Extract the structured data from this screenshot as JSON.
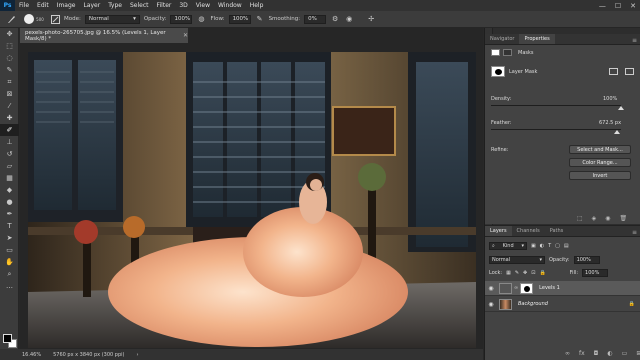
{
  "menubar": {
    "logo": "Ps",
    "items": [
      "File",
      "Edit",
      "Image",
      "Layer",
      "Type",
      "Select",
      "Filter",
      "3D",
      "View",
      "Window",
      "Help"
    ],
    "window_controls": [
      "—",
      "☐",
      "✕"
    ]
  },
  "options_bar": {
    "brush_size": "500",
    "mode_label": "Mode:",
    "mode_value": "Normal",
    "opacity_label": "Opacity:",
    "opacity_value": "100%",
    "flow_label": "Flow:",
    "flow_value": "100%",
    "smoothing_label": "Smoothing:",
    "smoothing_value": "0%"
  },
  "document": {
    "tab_title": "pexels-photo-265705.jpg @ 16.5% (Levels 1, Layer Mask/8) *",
    "zoom": "16.46%",
    "doc_info": "5760 px x 3840 px (300 ppi)"
  },
  "properties_panel": {
    "tabs": [
      "Navigator",
      "Properties"
    ],
    "active_tab": "Properties",
    "masks_label": "Masks",
    "layer_mask_label": "Layer Mask",
    "density_label": "Density:",
    "density_value": "100%",
    "density_level": 1.0,
    "feather_label": "Feather:",
    "feather_value": "672.5 px",
    "feather_level": 0.97,
    "refine_label": "Refine:",
    "select_and_mask": "Select and Mask...",
    "color_range": "Color Range...",
    "invert": "Invert"
  },
  "layers_panel": {
    "tabs": [
      "Layers",
      "Channels",
      "Paths"
    ],
    "active_tab": "Layers",
    "kind_label": "Kind",
    "blend_mode": "Normal",
    "opacity_label": "Opacity:",
    "opacity_value": "100%",
    "lock_label": "Lock:",
    "fill_label": "Fill:",
    "fill_value": "100%",
    "layers": [
      {
        "name": "Levels 1",
        "selected": true
      },
      {
        "name": "Background",
        "selected": false
      }
    ]
  },
  "colors": {
    "accent": "#31a8ff",
    "panel": "#434343",
    "workspace": "#282828"
  }
}
